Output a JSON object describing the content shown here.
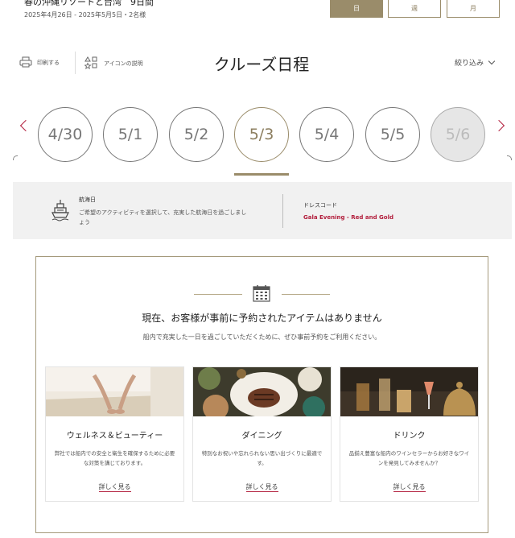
{
  "trip": {
    "title": "春の沖縄リゾートと台湾　9日間",
    "dates": "2025年4月26日 - 2025年5月5日・2名様"
  },
  "view_toggle": {
    "day": "日",
    "week": "週",
    "month": "月"
  },
  "utilities": {
    "print": "印刷する",
    "legend": "アイコンの説明"
  },
  "page_title": "クルーズ日程",
  "filter_label": "絞り込み",
  "dates": [
    "4/30",
    "5/1",
    "5/2",
    "5/3",
    "5/4",
    "5/5",
    "5/6"
  ],
  "selected_date": "5/3",
  "sea_day": {
    "title": "航海日",
    "description": "ご希望のアクティビティを選択して、充実した航海日を過ごしましょう"
  },
  "dress_code": {
    "title": "ドレスコード",
    "value": "Gala Evening - Red and Gold"
  },
  "empty_state": {
    "title": "現在、お客様が事前に予約されたアイテムはありません",
    "subtitle": "船内で充実した一日を過ごしていただくために、ぜひ事前予約をご利用ください。"
  },
  "cards": [
    {
      "title": "ウェルネス＆ビューティー",
      "description": "弊社では船内での安全と衛生を確保するために必要な対策を講じております。",
      "link": "詳しく見る"
    },
    {
      "title": "ダイニング",
      "description": "特別なお祝いや忘れられない思い出づくりに最適です。",
      "link": "詳しく見る"
    },
    {
      "title": "ドリンク",
      "description": "品揃え豊富な船内のワインセラーからお好きなワインを発見してみませんか？",
      "link": "詳しく見る"
    }
  ],
  "colors": {
    "accent_gold": "#9a8c6a",
    "accent_red": "#b21e3c",
    "info_bg": "#f1f1f1"
  }
}
